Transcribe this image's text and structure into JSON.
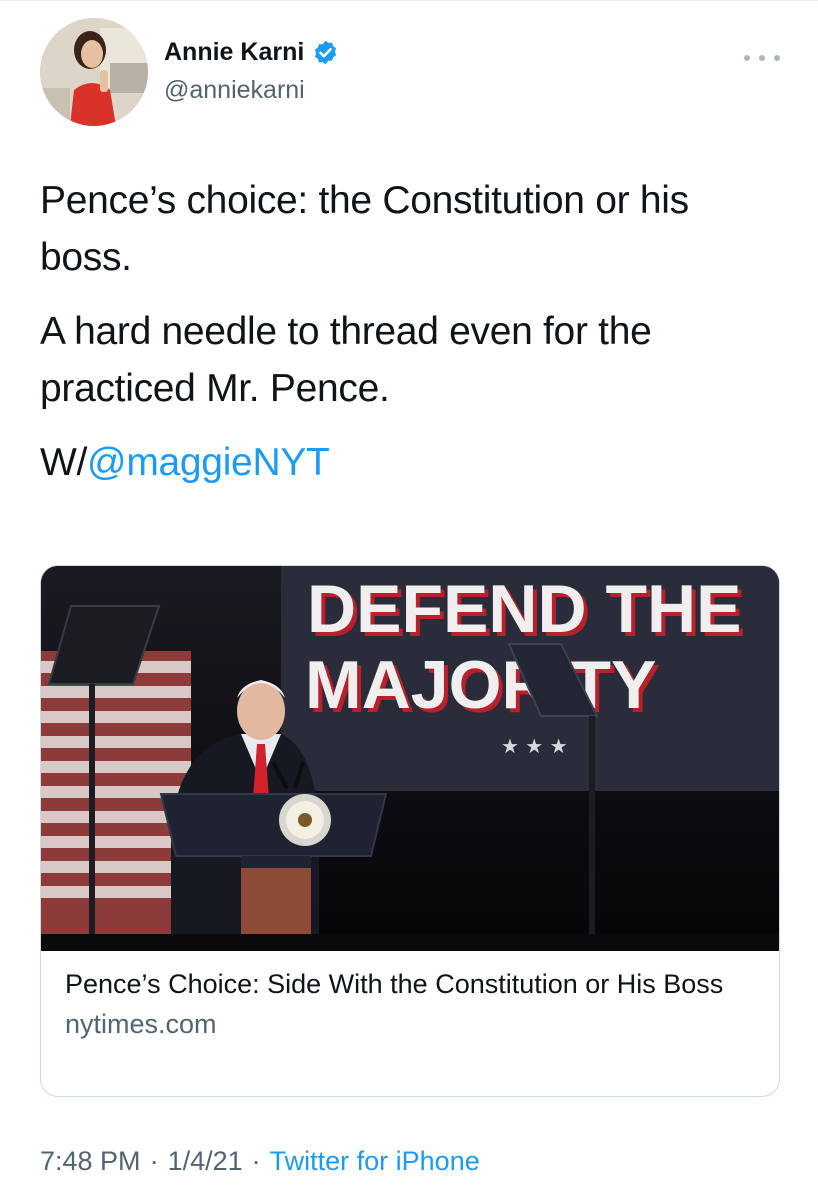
{
  "author": {
    "display_name": "Annie Karni",
    "handle": "@anniekarni",
    "verified_icon": "verified-badge-icon",
    "more_icon": "more-options-icon"
  },
  "tweet": {
    "line1": "Pence’s choice: the Constitution or his boss.",
    "line2": "A hard needle to thread even for the practiced Mr. Pence.",
    "line3_prefix": "W/",
    "line3_mention": "@maggieNYT"
  },
  "card": {
    "image_text_line1": "DEFEND THE",
    "image_text_line2": "MAJORITY",
    "image_stars": "★ ★ ★",
    "title": "Pence’s Choice: Side With the Constitution or His Boss",
    "domain": "nytimes.com"
  },
  "meta": {
    "time": "7:48 PM",
    "sep1": "·",
    "date": "1/4/21",
    "sep2": "·",
    "source": "Twitter for iPhone"
  },
  "colors": {
    "accent": "#1d9bf0",
    "secondary_text": "#536471",
    "border": "#cfd9de"
  }
}
